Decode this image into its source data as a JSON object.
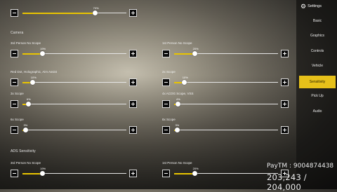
{
  "top_slider": {
    "value_text": "70%",
    "value": 70
  },
  "camera": {
    "title": "Camera",
    "rows": [
      {
        "left": {
          "label": "3rd Person No Scope",
          "value_text": "19%",
          "value": 19
        },
        "right": {
          "label": "1st Person No Scope",
          "value_text": "20%",
          "value": 20
        }
      },
      {
        "left": {
          "label": "Red Dot, Holographic, Aim Assist",
          "value_text": "10%",
          "value": 10
        },
        "right": {
          "label": "2x Scope",
          "value_text": "10%",
          "value": 10
        }
      },
      {
        "left": {
          "label": "3x Scope",
          "value_text": "6%",
          "value": 6
        },
        "right": {
          "label": "4x ACOG Scope, VSS",
          "value_text": "4%",
          "value": 4
        }
      },
      {
        "left": {
          "label": "6x Scope",
          "value_text": "3%",
          "value": 3
        },
        "right": {
          "label": "8x Scope",
          "value_text": "3%",
          "value": 3
        }
      }
    ]
  },
  "ads": {
    "title": "ADS Sensitivity",
    "rows": [
      {
        "left": {
          "label": "3rd Person No Scope",
          "value_text": "19%",
          "value": 19
        },
        "right": {
          "label": "1st Person No Scope",
          "value_text": "20%",
          "value": 20
        }
      }
    ]
  },
  "sidebar": {
    "title": "Settings",
    "items": [
      {
        "label": "Basic",
        "active": false
      },
      {
        "label": "Graphics",
        "active": false
      },
      {
        "label": "Controls",
        "active": false
      },
      {
        "label": "Vehicle",
        "active": false
      },
      {
        "label": "Sensitivity",
        "active": true
      },
      {
        "label": "Pick Up",
        "active": false
      },
      {
        "label": "Audio",
        "active": false
      }
    ]
  },
  "overlay": {
    "paytm": "PayTM : 9004874438",
    "counter": "203,243 / 204,000"
  },
  "colors": {
    "accent": "#e7c11a",
    "track": "#e6e6e6"
  },
  "icons": {
    "settings": "gear-icon",
    "decrease": "minus-icon",
    "increase": "plus-icon"
  }
}
